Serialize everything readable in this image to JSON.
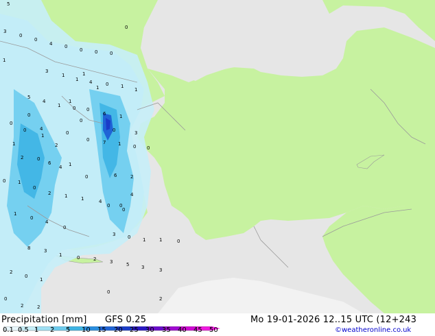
{
  "header": {
    "product": "Precipitation [mm]",
    "model": "GFS 0.25",
    "valid_time": "Mo 19-01-2026 12..15 UTC (12+243"
  },
  "legend": {
    "labels": [
      "0.1",
      "0.5",
      "1",
      "2",
      "5",
      "10",
      "15",
      "20",
      "25",
      "30",
      "35",
      "40",
      "45",
      "50"
    ],
    "colors": [
      "#e8f7fc",
      "#c6eef8",
      "#9fe0f4",
      "#6dccee",
      "#3eb4e4",
      "#2a8fe0",
      "#1f64d6",
      "#1a3cc8",
      "#2a18c4",
      "#6a0ccc",
      "#a00ad2",
      "#d008d4",
      "#f01ae0"
    ]
  },
  "credit": "©weatheronline.co.uk",
  "map": {
    "colors": {
      "sea": "#e6e6e6",
      "land_forecast": "#c7f2a0",
      "land_outside": "#f2f2f2",
      "borders": "#9a9a9a"
    },
    "values": [
      "5",
      "3",
      "0",
      "0",
      "4",
      "0",
      "0",
      "0",
      "0",
      "0",
      "1",
      "3",
      "1",
      "1",
      "4",
      "0",
      "1",
      "1",
      "5",
      "4",
      "1",
      "0",
      "0",
      "6",
      "1",
      "4",
      "0",
      "0",
      "7",
      "1",
      "0",
      "0",
      "0",
      "2",
      "6",
      "4",
      "1",
      "0",
      "1",
      "0",
      "2",
      "1",
      "1",
      "4",
      "6",
      "2",
      "1",
      "0",
      "4",
      "0",
      "8",
      "3",
      "1",
      "0",
      "2",
      "3",
      "5",
      "3",
      "3",
      "0",
      "2",
      "2",
      "2",
      "0",
      "1",
      "4",
      "0",
      "0",
      "3",
      "0",
      "1",
      "1",
      "0",
      "1",
      "1",
      "1",
      "0",
      "1",
      "2",
      "1",
      "0",
      "0",
      "2",
      "3",
      "0",
      "0",
      "0",
      "0",
      "0"
    ]
  }
}
